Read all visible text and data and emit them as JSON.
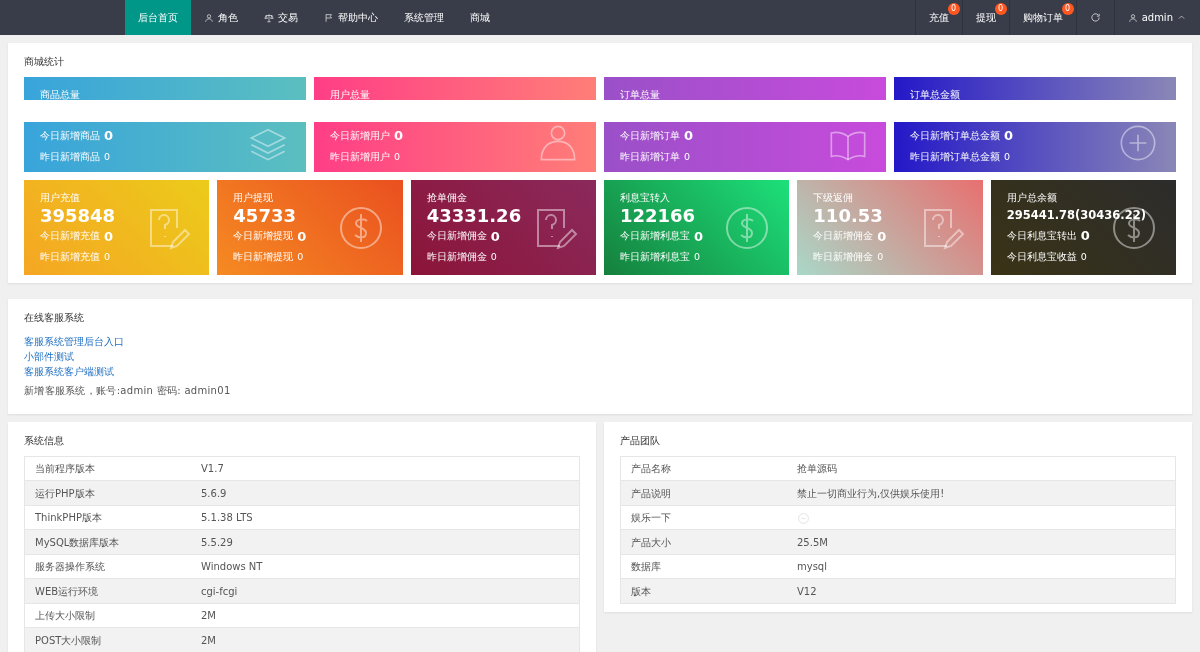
{
  "navbar": {
    "tabs": [
      {
        "label": "后台首页",
        "selected": true
      },
      {
        "label": "角色",
        "selected": false
      },
      {
        "label": "交易",
        "selected": false
      },
      {
        "label": "帮助中心",
        "selected": false
      },
      {
        "label": "系统管理",
        "selected": false
      },
      {
        "label": "商城",
        "selected": false
      }
    ],
    "right": [
      {
        "label": "充值",
        "badge": "0"
      },
      {
        "label": "提现",
        "badge": "0"
      },
      {
        "label": "购物订单",
        "badge": "0"
      }
    ],
    "user": "admin"
  },
  "stats": {
    "title": "商城统计",
    "top_cards": [
      {
        "title": "商品总量",
        "today": "今日新增商品",
        "today_value": "0",
        "yesterday": "昨日新增商品",
        "yesterday_value": "0"
      },
      {
        "title": "用户总量",
        "today": "今日新增用户",
        "today_value": "0",
        "yesterday": "昨日新增用户",
        "yesterday_value": "0"
      },
      {
        "title": "订单总量",
        "today": "今日新增订单",
        "today_value": "0",
        "yesterday": "昨日新增订单",
        "yesterday_value": "0"
      },
      {
        "title": "订单总金额",
        "today": "今日新增订单总金额",
        "today_value": "0",
        "yesterday": "昨日新增订单总金额",
        "yesterday_value": "0"
      }
    ],
    "cards": [
      {
        "title": "用户充值",
        "value": "395848",
        "today": "今日新增充值",
        "today_value": "0",
        "yesterday": "昨日新增充值",
        "yesterday_value": "0"
      },
      {
        "title": "用户提现",
        "value": "45733",
        "today": "今日新增提现",
        "today_value": "0",
        "yesterday": "昨日新增提现",
        "yesterday_value": "0"
      },
      {
        "title": "抢单佣金",
        "value": "43331.26",
        "today": "今日新增佣金",
        "today_value": "0",
        "yesterday": "昨日新增佣金",
        "yesterday_value": "0"
      },
      {
        "title": "利息宝转入",
        "value": "122166",
        "today": "今日新增利息宝",
        "today_value": "0",
        "yesterday": "昨日新增利息宝",
        "yesterday_value": "0"
      },
      {
        "title": "下级返佣",
        "value": "110.53",
        "today": "今日新增佣金",
        "today_value": "0",
        "yesterday": "昨日新增佣金",
        "yesterday_value": "0"
      },
      {
        "title": "用户总余额",
        "value": "295441.78(30436.22)",
        "today": "今日利息宝转出",
        "today_value": "0",
        "yesterday": "今日利息宝收益",
        "yesterday_value": "0"
      }
    ]
  },
  "service": {
    "title": "在线客服系统",
    "links": [
      "客服系统管理后台入口",
      "小部件测试",
      "客服系统客户端测试"
    ],
    "note": "新增客服系统，账号:admin 密码: admin01"
  },
  "system_info": {
    "title": "系统信息",
    "rows": [
      {
        "label": "当前程序版本",
        "value": "V1.7"
      },
      {
        "label": "运行PHP版本",
        "value": "5.6.9"
      },
      {
        "label": "ThinkPHP版本",
        "value": "5.1.38 LTS"
      },
      {
        "label": "MySQL数据库版本",
        "value": "5.5.29"
      },
      {
        "label": "服务器操作系统",
        "value": "Windows NT"
      },
      {
        "label": "WEB运行环境",
        "value": "cgi-fcgi"
      },
      {
        "label": "上传大小限制",
        "value": "2M"
      },
      {
        "label": "POST大小限制",
        "value": "2M"
      }
    ]
  },
  "team": {
    "title": "产品团队",
    "rows": [
      {
        "label": "产品名称",
        "kind": "text",
        "value": "抢单源码"
      },
      {
        "label": "产品说明",
        "kind": "text",
        "value": "禁止一切商业行为,仅供娱乐使用!"
      },
      {
        "label": "娱乐一下",
        "kind": "icon"
      },
      {
        "label": "产品大小",
        "kind": "link",
        "value": "25.5M"
      },
      {
        "label": "数据库",
        "kind": "link",
        "value": "mysql"
      },
      {
        "label": "版本",
        "kind": "text",
        "value": "V12"
      }
    ]
  }
}
